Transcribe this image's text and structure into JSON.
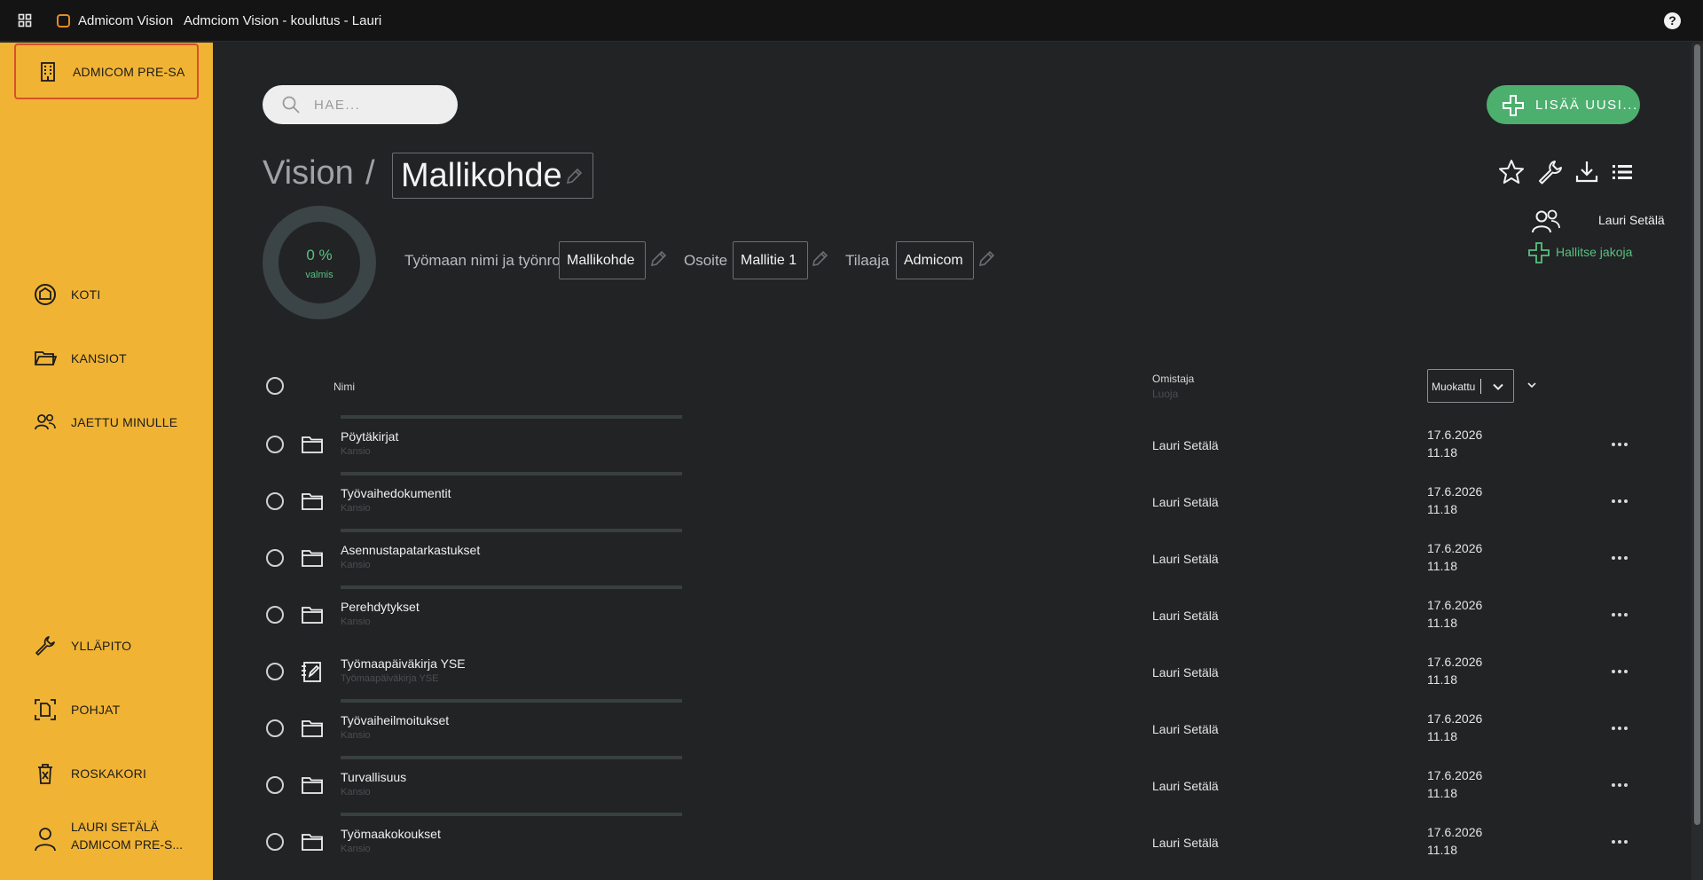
{
  "topbar": {
    "app_name": "Admicom Vision",
    "window_title": "Admciom Vision - koulutus - Lauri",
    "help": "?"
  },
  "sidebar": {
    "org": "ADMICOM PRE-SA",
    "items": [
      {
        "label": "KOTI",
        "icon": "home-icon"
      },
      {
        "label": "KANSIOT",
        "icon": "folder-icon"
      },
      {
        "label": "JAETTU MINULLE",
        "icon": "shared-users-icon"
      },
      {
        "label": "YLLÄPITO",
        "icon": "wrench-icon"
      },
      {
        "label": "POHJAT",
        "icon": "template-icon"
      },
      {
        "label": "ROSKAKORI",
        "icon": "trash-icon"
      }
    ],
    "user": {
      "name": "LAURI SETÄLÄ",
      "org": "ADMICOM PRE-S..."
    }
  },
  "search": {
    "placeholder": "HAE..."
  },
  "add_button": {
    "label": "LISÄÄ UUSI..."
  },
  "breadcrumb": {
    "root": "Vision",
    "separator": "/",
    "current": "Mallikohde"
  },
  "progress": {
    "value": 0,
    "text": "0 %",
    "label": "valmis"
  },
  "fields": [
    {
      "label": "Työmaan nimi ja työnro",
      "value": "Mallikohde"
    },
    {
      "label": "Osoite",
      "value": "Mallitie 1"
    },
    {
      "label": "Tilaaja",
      "value": "Admicom"
    }
  ],
  "sharing": {
    "user": "Lauri Setälä",
    "manage_label": "Hallitse jakoja"
  },
  "table": {
    "col_name": "Nimi",
    "col_owner": "Omistaja",
    "col_creator": "Luoja",
    "sort_label": "Muokattu",
    "rows": [
      {
        "name": "Pöytäkirjat",
        "type": "Kansio",
        "icon": "folder",
        "owner": "Lauri Setälä",
        "date": "17.6.2026",
        "time": "11.18"
      },
      {
        "name": "Työvaihedokumentit",
        "type": "Kansio",
        "icon": "folder",
        "owner": "Lauri Setälä",
        "date": "17.6.2026",
        "time": "11.18"
      },
      {
        "name": "Asennustapatarkastukset",
        "type": "Kansio",
        "icon": "folder",
        "owner": "Lauri Setälä",
        "date": "17.6.2026",
        "time": "11.18"
      },
      {
        "name": "Perehdytykset",
        "type": "Kansio",
        "icon": "folder",
        "owner": "Lauri Setälä",
        "date": "17.6.2026",
        "time": "11.18"
      },
      {
        "name": "Työmaapäiväkirja YSE",
        "type": "Työmaapäiväkirja YSE",
        "icon": "diary",
        "owner": "Lauri Setälä",
        "date": "17.6.2026",
        "time": "11.18"
      },
      {
        "name": "Työvaiheilmoitukset",
        "type": "Kansio",
        "icon": "folder",
        "owner": "Lauri Setälä",
        "date": "17.6.2026",
        "time": "11.18"
      },
      {
        "name": "Turvallisuus",
        "type": "Kansio",
        "icon": "folder",
        "owner": "Lauri Setälä",
        "date": "17.6.2026",
        "time": "11.18"
      },
      {
        "name": "Työmaakokoukset",
        "type": "Kansio",
        "icon": "folder",
        "owner": "Lauri Setälä",
        "date": "17.6.2026",
        "time": "11.18"
      }
    ]
  },
  "colors": {
    "sidebar": "#f0b334",
    "accent_green": "#4caf6e",
    "background": "#222325",
    "org_border": "#d9502a"
  }
}
